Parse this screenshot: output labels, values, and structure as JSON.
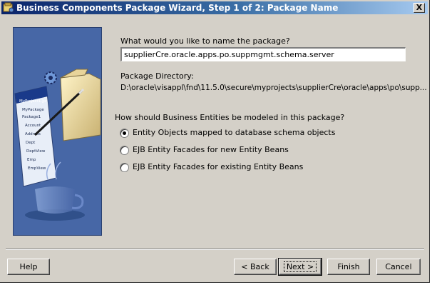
{
  "window": {
    "title": "Business Components Package Wizard, Step 1 of 2: Package Name",
    "close_label": "X"
  },
  "form": {
    "name_prompt": "What would you like to name the package?",
    "package_name": "supplierCre.oracle.apps.po.suppmgmt.schema.server",
    "dir_label": "Package Directory:",
    "dir_value": "D:\\oracle\\visappl\\fnd\\11.5.0\\secure\\myprojects\\supplierCre\\oracle\\apps\\po\\supp...",
    "model_prompt": "How should Business Entities be modeled in this package?",
    "options": [
      {
        "label": "Entity Objects mapped to database schema objects",
        "selected": true
      },
      {
        "label": "EJB Entity Facades for new Entity Beans",
        "selected": false
      },
      {
        "label": "EJB Entity Facades for existing Entity Beans",
        "selected": false
      }
    ]
  },
  "buttons": {
    "help": "Help",
    "back": "< Back",
    "next": "Next >",
    "finish": "Finish",
    "cancel": "Cancel"
  },
  "banner": {
    "tree_items": [
      "MyProject1.jpr",
      "MyPackage",
      "Package1",
      "Account",
      "Address",
      "Dept",
      "DeptView",
      "Emp",
      "EmpView"
    ]
  },
  "colors": {
    "dialog_bg": "#d4d0c8",
    "title_start": "#0a246a",
    "title_end": "#a6caf0",
    "banner_bg": "#3d5e9e"
  },
  "icons": {
    "title": "wizard-icon",
    "banner": "package-wizard-illustration"
  }
}
